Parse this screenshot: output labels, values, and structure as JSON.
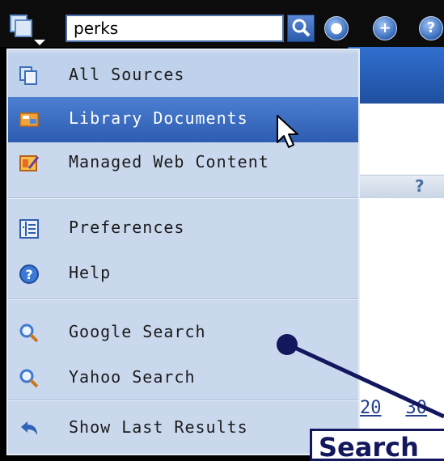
{
  "search": {
    "value": "perks"
  },
  "menu": {
    "items": [
      {
        "label": "All Sources",
        "icon": "sources-icon"
      },
      {
        "label": "Library Documents",
        "icon": "library-documents-icon",
        "selected": true
      },
      {
        "label": "Managed Web Content",
        "icon": "managed-web-content-icon"
      },
      {
        "label": "Preferences",
        "icon": "preferences-icon"
      },
      {
        "label": "Help",
        "icon": "help-icon"
      },
      {
        "label": "Google Search",
        "icon": "search-icon"
      },
      {
        "label": "Yahoo Search",
        "icon": "search-icon"
      },
      {
        "label": "Show Last Results",
        "icon": "back-arrow-icon"
      }
    ]
  },
  "background": {
    "help_mark": "?",
    "pager": [
      "20",
      "30"
    ]
  },
  "callout": {
    "text": "Search"
  },
  "colors": {
    "accent": "#2d5cb0",
    "menu_bg": "#cad8ee",
    "annotation": "#13185e"
  }
}
